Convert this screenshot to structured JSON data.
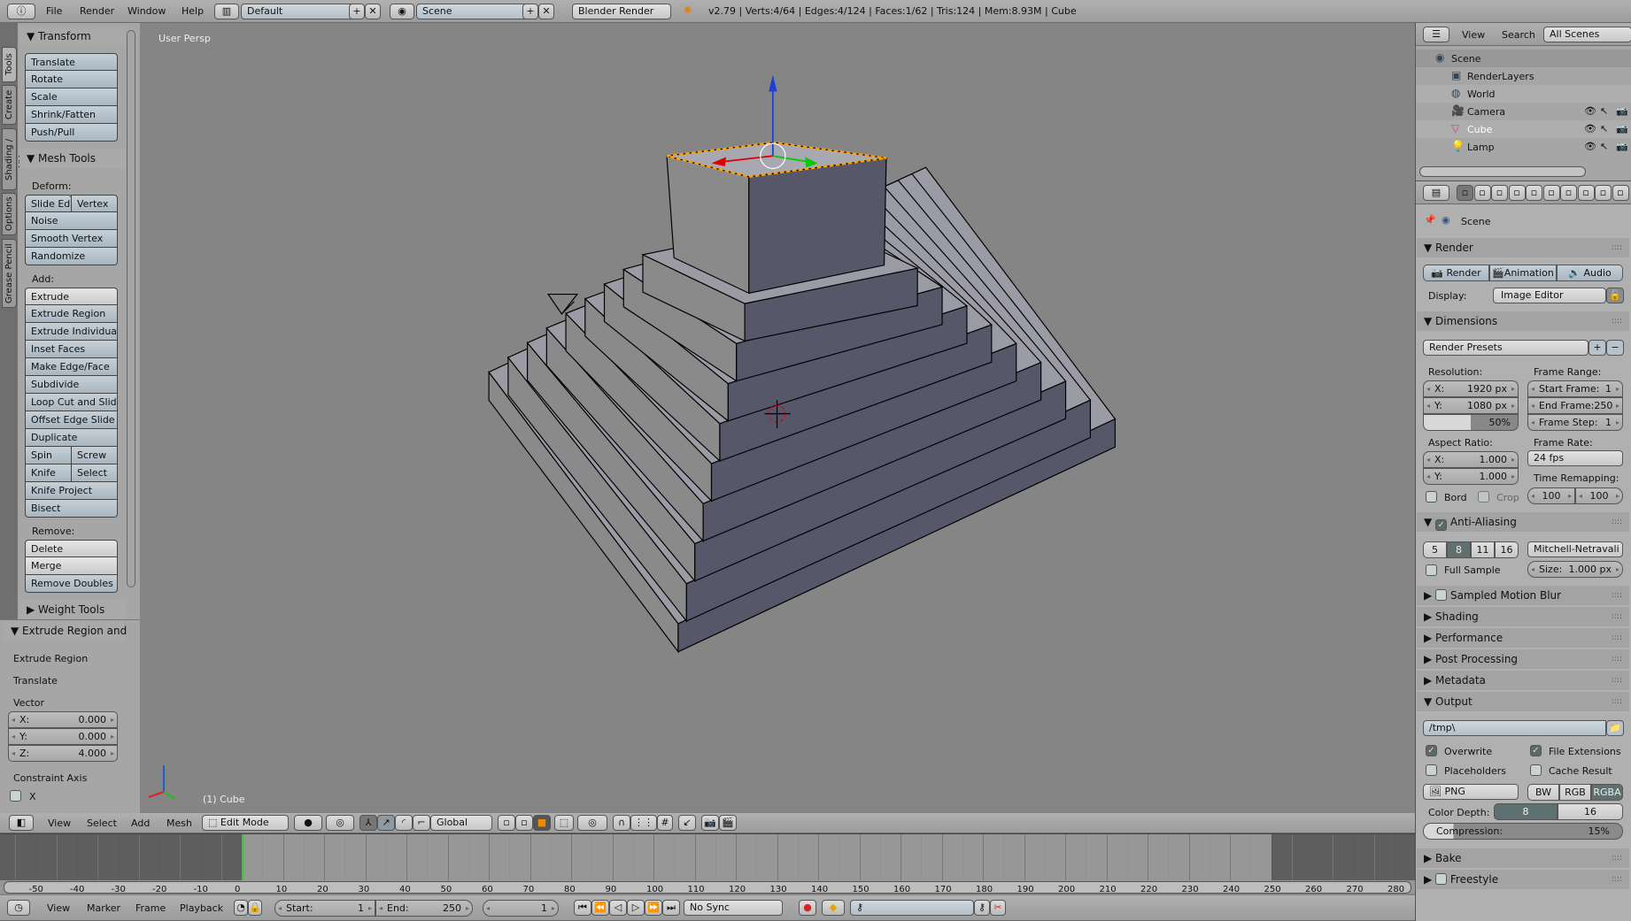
{
  "topbar": {
    "menus": [
      "File",
      "Render",
      "Window",
      "Help"
    ],
    "layout": "Default",
    "scene": "Scene",
    "engine": "Blender Render",
    "stats": "v2.79 | Verts:4/64 | Edges:4/124 | Faces:1/62 | Tris:124 | Mem:8.93M | Cube"
  },
  "toolbar": {
    "tabs": [
      "Tools",
      "Create",
      "Shading / UVs",
      "Options",
      "Grease Pencil"
    ],
    "transform": {
      "title": "Transform",
      "buttons": [
        "Translate",
        "Rotate",
        "Scale",
        "Shrink/Fatten",
        "Push/Pull"
      ]
    },
    "mesh_tools": {
      "title": "Mesh Tools",
      "deform_label": "Deform:",
      "deform": [
        "Slide Ed",
        "Vertex",
        "Noise",
        "Smooth Vertex",
        "Randomize"
      ],
      "add_label": "Add:",
      "add": [
        "Extrude",
        "Extrude Region",
        "Extrude Individual",
        "Inset Faces",
        "Make Edge/Face",
        "Subdivide",
        "Loop Cut and Slide",
        "Offset Edge Slide",
        "Duplicate",
        "Spin",
        "Screw",
        "Knife",
        "Select",
        "Knife Project",
        "Bisect"
      ],
      "remove_label": "Remove:",
      "remove": [
        "Delete",
        "Merge",
        "Remove Doubles"
      ]
    },
    "weight_tools": "Weight Tools"
  },
  "operator": {
    "title": "Extrude Region and",
    "items": [
      "Extrude Region",
      "Translate"
    ],
    "vector_label": "Vector",
    "x_label": "X:",
    "x": "0.000",
    "y_label": "Y:",
    "y": "0.000",
    "z_label": "Z:",
    "z": "4.000",
    "constraint_label": "Constraint Axis",
    "constraint_x": "X",
    "constraint_x_checked": false
  },
  "viewport": {
    "view_name": "User Persp",
    "object_label": "(1) Cube",
    "colors": {
      "background": "#858585",
      "top_face": "#9b9ba6",
      "left_face": "#8a8a8a",
      "right_face": "#57576a",
      "selected_edge": "#ffa000"
    }
  },
  "viewport_header": {
    "menus": [
      "View",
      "Select",
      "Add",
      "Mesh"
    ],
    "mode": "Edit Mode",
    "orientation": "Global"
  },
  "timeline": {
    "ticks": [
      -50,
      -40,
      -30,
      -20,
      -10,
      0,
      10,
      20,
      30,
      40,
      50,
      60,
      70,
      80,
      90,
      100,
      110,
      120,
      130,
      140,
      150,
      160,
      170,
      180,
      190,
      200,
      210,
      220,
      230,
      240,
      250,
      260,
      270,
      280
    ],
    "current_frame": 1,
    "start": 1,
    "end": 250,
    "menus": [
      "View",
      "Marker",
      "Frame",
      "Playback"
    ],
    "start_label": "Start:",
    "start_value": "1",
    "end_label": "End:",
    "end_value": "250",
    "frame_value": "1",
    "sync": "No Sync"
  },
  "outliner": {
    "menus": [
      "View",
      "Search"
    ],
    "filter": "All Scenes",
    "items": [
      {
        "label": "Scene",
        "icon": "scene-icon"
      },
      {
        "label": "RenderLayers",
        "icon": "render-layers-icon"
      },
      {
        "label": "World",
        "icon": "world-icon"
      },
      {
        "label": "Camera",
        "icon": "camera-icon"
      },
      {
        "label": "Cube",
        "icon": "mesh-icon",
        "selected": true
      },
      {
        "label": "Lamp",
        "icon": "lamp-icon"
      }
    ]
  },
  "properties": {
    "context": "Scene",
    "render": {
      "title": "Render",
      "buttons": [
        "Render",
        "Animation",
        "Audio"
      ],
      "display_label": "Display:",
      "display": "Image Editor"
    },
    "dimensions": {
      "title": "Dimensions",
      "presets": "Render Presets",
      "resolution_label": "Resolution:",
      "res_x_label": "X:",
      "res_x": "1920 px",
      "res_y_label": "Y:",
      "res_y": "1080 px",
      "percent": "50%",
      "percent_value": 50,
      "frame_range_label": "Frame Range:",
      "start_label": "Start Frame:",
      "start": "1",
      "end_label": "End Frame:",
      "end": "250",
      "step_label": "Frame Step:",
      "step": "1",
      "aspect_label": "Aspect Ratio:",
      "asp_x_label": "X:",
      "asp_x": "1.000",
      "asp_y_label": "Y:",
      "asp_y": "1.000",
      "frame_rate_label": "Frame Rate:",
      "frame_rate": "24 fps",
      "remap_label": "Time Remapping:",
      "remap_old": "100",
      "remap_new": "100",
      "bord": "Bord",
      "crop": "Crop"
    },
    "anti_aliasing": {
      "title": "Anti-Aliasing",
      "samples": [
        "5",
        "8",
        "11",
        "16"
      ],
      "selected": "8",
      "filter": "Mitchell-Netravali",
      "full_sample": "Full Sample",
      "size_label": "Size:",
      "size": "1.000 px"
    },
    "collapsed": [
      "Sampled Motion Blur",
      "Shading",
      "Performance",
      "Post Processing",
      "Metadata"
    ],
    "output": {
      "title": "Output",
      "path": "/tmp\\",
      "overwrite": "Overwrite",
      "file_extensions": "File Extensions",
      "placeholders": "Placeholders",
      "cache_result": "Cache Result",
      "format": "PNG",
      "color_modes": [
        "BW",
        "RGB",
        "RGBA"
      ],
      "color_mode": "RGBA",
      "depth_label": "Color Depth:",
      "depths": [
        "8",
        "16"
      ],
      "depth": "8",
      "compression_label": "Compression:",
      "compression": "15%",
      "compression_value": 15
    },
    "bake": "Bake",
    "freestyle": "Freestyle"
  }
}
